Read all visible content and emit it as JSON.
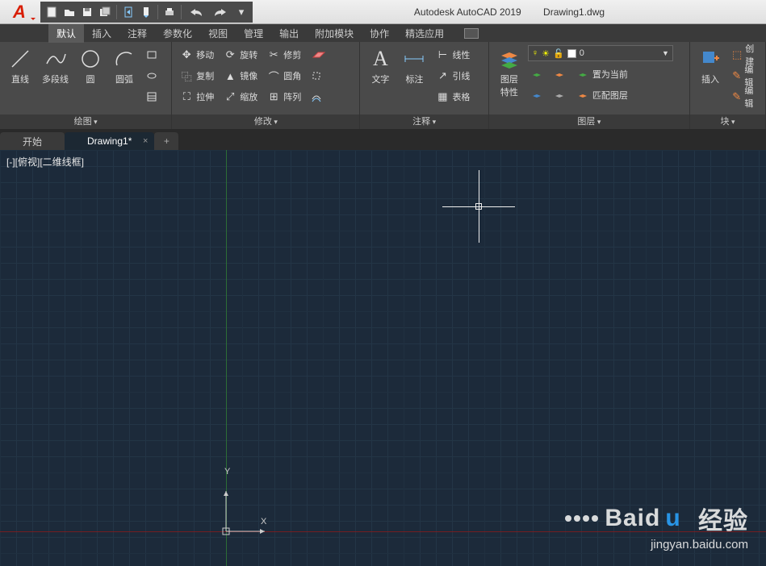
{
  "app": {
    "title": "Autodesk AutoCAD 2019",
    "file": "Drawing1.dwg",
    "logo": "A"
  },
  "qat": [
    "new",
    "open",
    "save",
    "saveall",
    "share",
    "cloud",
    "print",
    "undo",
    "redo"
  ],
  "menu": {
    "items": [
      "默认",
      "插入",
      "注释",
      "参数化",
      "视图",
      "管理",
      "输出",
      "附加模块",
      "协作",
      "精选应用"
    ],
    "active": 0
  },
  "ribbon": {
    "draw": {
      "title": "绘图",
      "line": "直线",
      "pline": "多段线",
      "circle": "圆",
      "arc": "圆弧"
    },
    "modify": {
      "title": "修改",
      "move": "移动",
      "rotate": "旋转",
      "trim": "修剪",
      "copy": "复制",
      "mirror": "镜像",
      "fillet": "圆角",
      "stretch": "拉伸",
      "scale": "缩放",
      "array": "阵列"
    },
    "annot": {
      "title": "注释",
      "text": "文字",
      "dim": "标注",
      "linear": "线性",
      "leader": "引线",
      "table": "表格"
    },
    "layers": {
      "title": "图层",
      "props": "图层\n特性",
      "current": "0",
      "setcur": "置为当前",
      "match": "匹配图层"
    },
    "block": {
      "title": "块",
      "insert": "插入",
      "create": "创建",
      "edit": "编辑",
      "editattr": "编辑"
    }
  },
  "tabs": {
    "start": "开始",
    "drawing": "Drawing1*"
  },
  "view": {
    "label": "[-][俯视][二维线框]",
    "ucs": {
      "x": "X",
      "y": "Y"
    }
  },
  "watermark": {
    "main": "Baid",
    "jy": "经验",
    "sub": "jingyan.baidu.com"
  }
}
